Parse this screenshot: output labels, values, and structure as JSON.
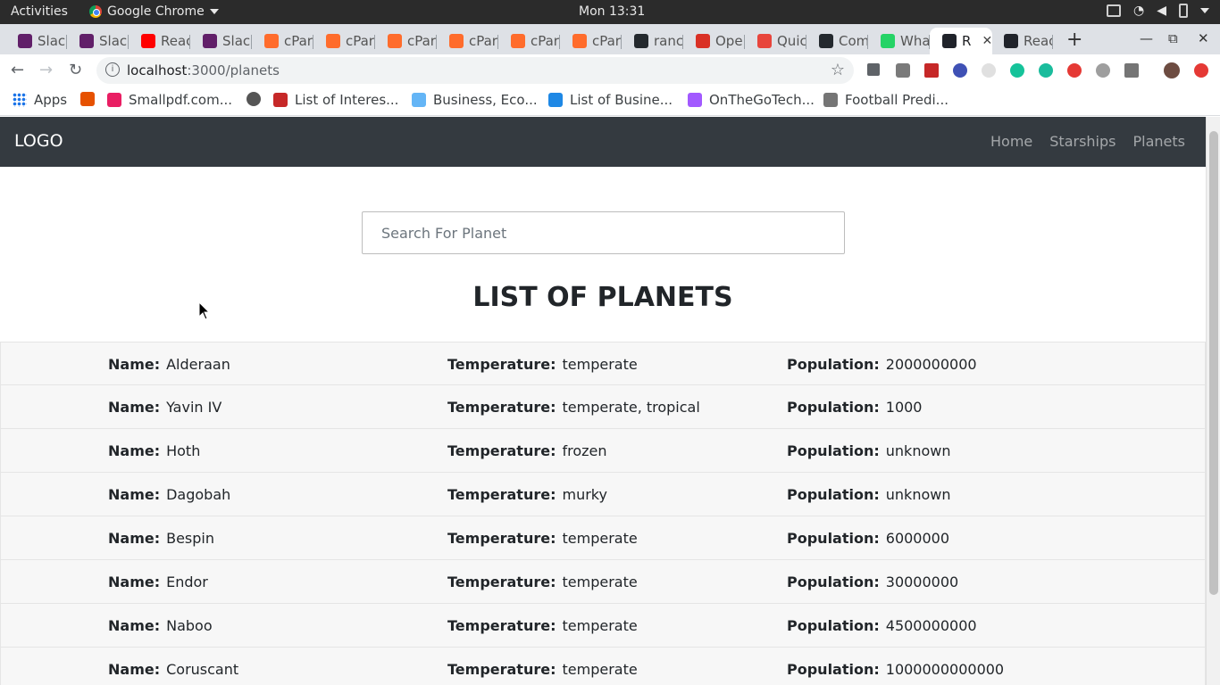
{
  "os_bar": {
    "activities": "Activities",
    "app_name": "Google Chrome",
    "clock": "Mon 13:31"
  },
  "tabs": [
    {
      "label": "Slac",
      "color": "#611f69"
    },
    {
      "label": "Slac",
      "color": "#611f69"
    },
    {
      "label": "Reac",
      "color": "#ff0000"
    },
    {
      "label": "Slac",
      "color": "#611f69"
    },
    {
      "label": "cPar",
      "color": "#ff6c2c"
    },
    {
      "label": "cPar",
      "color": "#ff6c2c"
    },
    {
      "label": "cPar",
      "color": "#ff6c2c"
    },
    {
      "label": "cPar",
      "color": "#ff6c2c"
    },
    {
      "label": "cPar",
      "color": "#ff6c2c"
    },
    {
      "label": "cPar",
      "color": "#ff6c2c"
    },
    {
      "label": "ranc",
      "color": "#24292e"
    },
    {
      "label": "Ope",
      "color": "#d93025"
    },
    {
      "label": "Quic",
      "color": "#e8453c"
    },
    {
      "label": "Com",
      "color": "#24292e"
    },
    {
      "label": "Wha",
      "color": "#25d366"
    },
    {
      "label": "R",
      "color": "#20232a",
      "active": true
    },
    {
      "label": "Reac",
      "color": "#20232a"
    }
  ],
  "address_bar": {
    "host": "localhost",
    "path": ":3000/planets"
  },
  "bookmarks": [
    {
      "label": "Apps",
      "icon": "apps-grid-icon"
    },
    {
      "label": "",
      "icon": "flame-icon"
    },
    {
      "label": "Smallpdf.com...",
      "icon": "smallpdf-icon"
    },
    {
      "label": "",
      "icon": "globe-icon"
    },
    {
      "label": "List of Interes...",
      "icon": "bookmark-page-icon"
    },
    {
      "label": "Business, Eco...",
      "icon": "cloud-icon"
    },
    {
      "label": "List of Busine...",
      "icon": "refresh-logo-icon"
    },
    {
      "label": "OnTheGoTech...",
      "icon": "figma-icon"
    },
    {
      "label": "Football Predi...",
      "icon": "football-icon"
    }
  ],
  "app": {
    "logo": "LOGO",
    "nav": [
      "Home",
      "Starships",
      "Planets"
    ],
    "search_placeholder": "Search For Planet",
    "heading": "LIST OF PLANETS",
    "labels": {
      "name": "Name:",
      "temperature": "Temperature:",
      "population": "Population:"
    },
    "planets": [
      {
        "name": "Alderaan",
        "temperature": "temperate",
        "population": "2000000000"
      },
      {
        "name": "Yavin IV",
        "temperature": "temperate, tropical",
        "population": "1000"
      },
      {
        "name": "Hoth",
        "temperature": "frozen",
        "population": "unknown"
      },
      {
        "name": "Dagobah",
        "temperature": "murky",
        "population": "unknown"
      },
      {
        "name": "Bespin",
        "temperature": "temperate",
        "population": "6000000"
      },
      {
        "name": "Endor",
        "temperature": "temperate",
        "population": "30000000"
      },
      {
        "name": "Naboo",
        "temperature": "temperate",
        "population": "4500000000"
      },
      {
        "name": "Coruscant",
        "temperature": "temperate",
        "population": "1000000000000"
      }
    ]
  }
}
